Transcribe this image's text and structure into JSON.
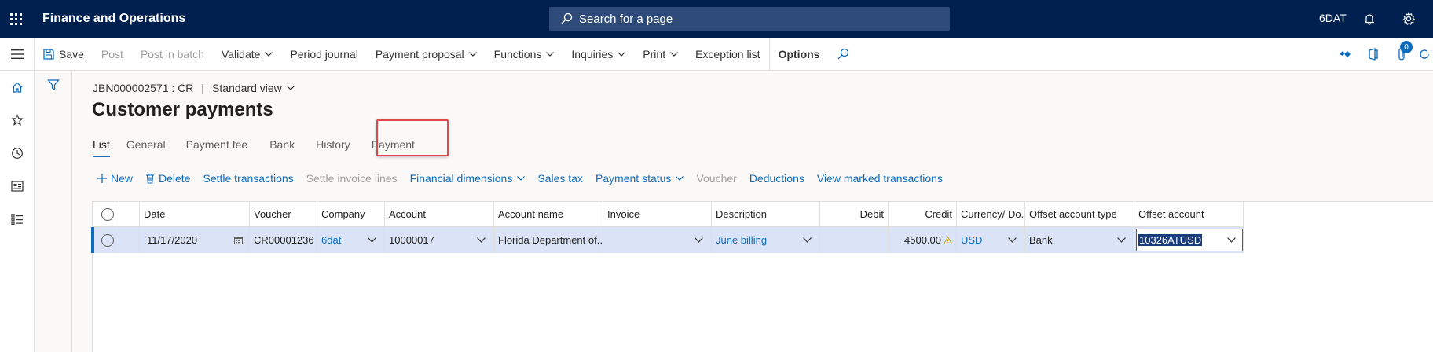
{
  "app": {
    "title": "Finance and Operations",
    "search_placeholder": "Search for a page",
    "company": "6DAT"
  },
  "actions": {
    "save": "Save",
    "post": "Post",
    "post_in_batch": "Post in batch",
    "validate": "Validate",
    "period_journal": "Period journal",
    "payment_proposal": "Payment proposal",
    "functions": "Functions",
    "inquiries": "Inquiries",
    "print": "Print",
    "exception_list": "Exception list",
    "options": "Options",
    "notification_count": "0"
  },
  "page": {
    "journal_id": "JBN000002571 : CR",
    "separator": "|",
    "view": "Standard view",
    "title": "Customer payments"
  },
  "tabs": [
    "List",
    "General",
    "Payment fee",
    "Bank",
    "History",
    "Payment"
  ],
  "grid_actions": {
    "new": "New",
    "delete": "Delete",
    "settle_transactions": "Settle transactions",
    "settle_invoice_lines": "Settle invoice lines",
    "financial_dimensions": "Financial dimensions",
    "sales_tax": "Sales tax",
    "payment_status": "Payment status",
    "voucher": "Voucher",
    "deductions": "Deductions",
    "view_marked": "View marked transactions"
  },
  "columns": [
    "Date",
    "Voucher",
    "Company",
    "Account",
    "Account name",
    "Invoice",
    "Description",
    "Debit",
    "Credit",
    "Currency/ Do...",
    "Offset account type",
    "Offset account"
  ],
  "row": {
    "date": "11/17/2020",
    "voucher": "CR00001236",
    "company": "6dat",
    "account": "10000017",
    "account_name": "Florida Department of...",
    "invoice": "",
    "description": "June billing",
    "debit": "",
    "credit": "4500.00",
    "currency": "USD",
    "offset_account_type": "Bank",
    "offset_account": "10326ATUSD"
  },
  "colors": {
    "nav": "#002050",
    "accent": "#0f6cbd",
    "selected_row": "#dbe4f6",
    "highlight_box": "#e24848",
    "warning": "#d8a21a"
  }
}
